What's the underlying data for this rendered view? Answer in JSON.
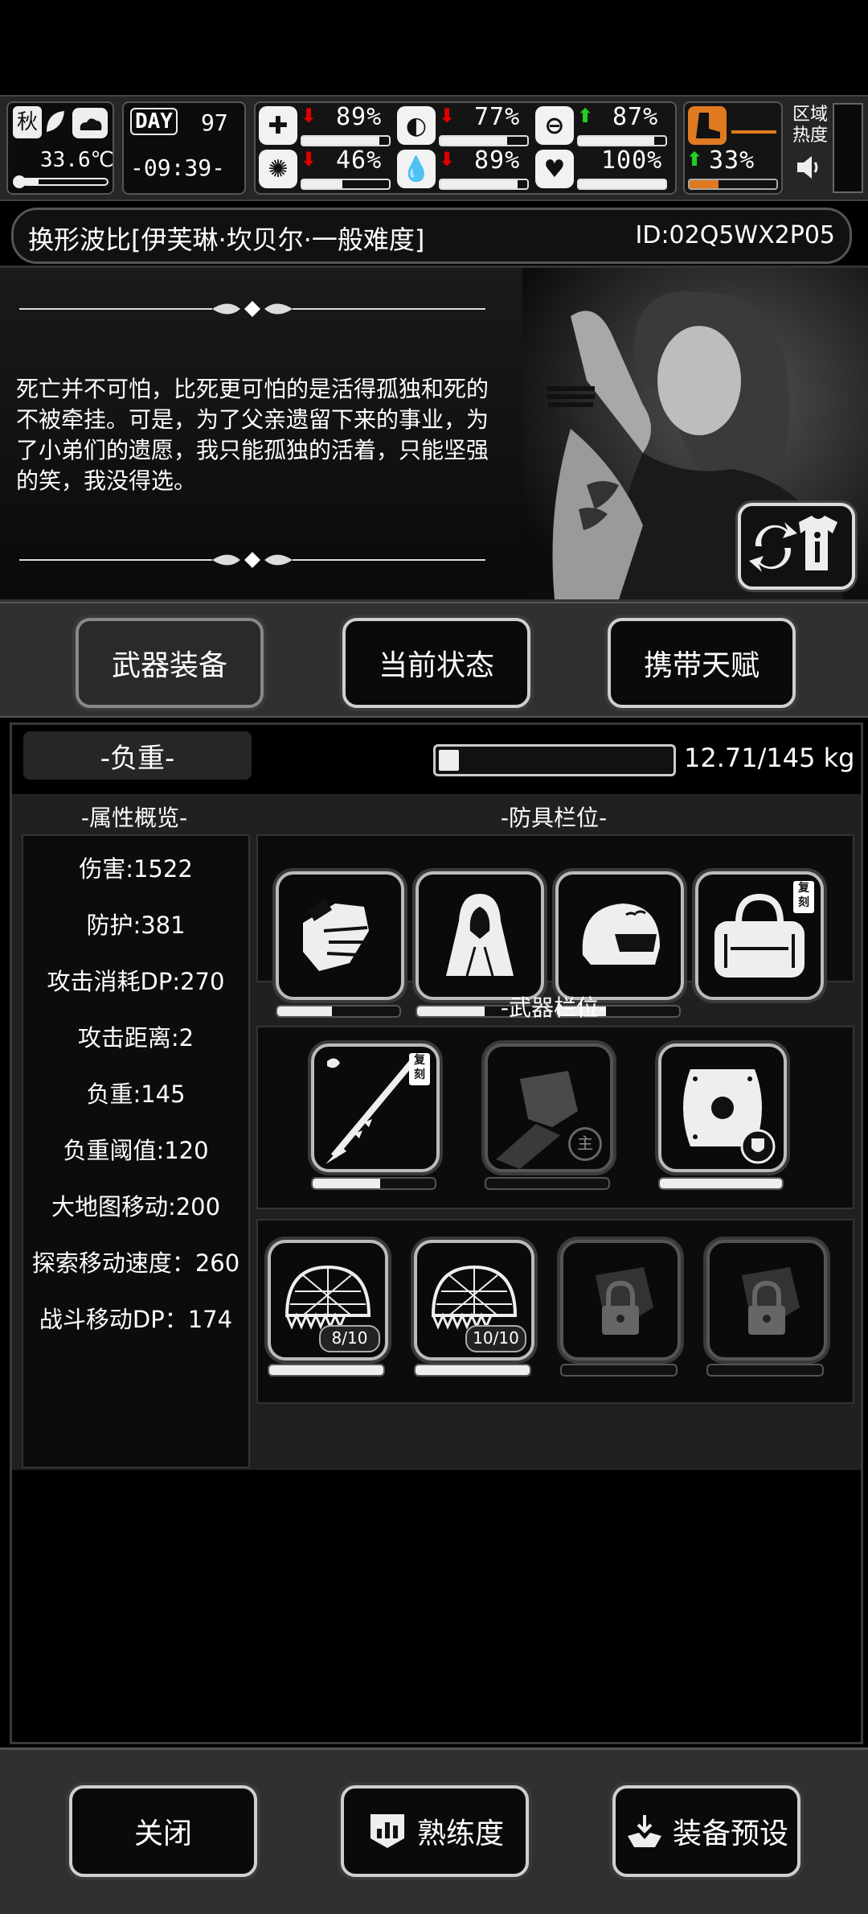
{
  "status": {
    "season": "秋",
    "temperature": "33.6℃",
    "day_label": "DAY",
    "day_value": "97",
    "clock": "-09:39-",
    "stats": [
      {
        "name": "health",
        "trend": "down",
        "value": "89%",
        "level": 0.89
      },
      {
        "name": "hunger",
        "trend": "down",
        "value": "77%",
        "level": 0.77
      },
      {
        "name": "stamina",
        "trend": "up",
        "value": "87%",
        "level": 0.87
      },
      {
        "name": "mind",
        "trend": "down",
        "value": "46%",
        "level": 0.46
      },
      {
        "name": "thirst",
        "trend": "down",
        "value": "89%",
        "level": 0.89
      },
      {
        "name": "heart",
        "trend": "none",
        "value": "100%",
        "level": 1.0
      },
      {
        "name": "speed",
        "trend": "up",
        "value": "33%",
        "level": 0.33
      }
    ],
    "region_heat_label": "区域\n热度"
  },
  "title": {
    "character": "换形波比[伊芙琳·坎贝尔·一般难度]",
    "id": "ID:02Q5WX2P05"
  },
  "bio": "死亡并不可怕，比死更可怕的是活得孤独和死的不被牵挂。可是，为了父亲遗留下来的事业，为了小弟们的遗愿，我只能孤独的活着，只能坚强的笑，我没得选。",
  "tabs": [
    "武器装备",
    "当前状态",
    "携带天赋"
  ],
  "weight": {
    "label": "-负重-",
    "text": "12.71/145 kg",
    "fraction": 0.088
  },
  "attributes": {
    "header": "-属性概览-",
    "items": [
      "伤害:1522",
      "防护:381",
      "攻击消耗DP:270",
      "攻击距离:2",
      "负重:145",
      "负重阈值:120",
      "大地图移动:200",
      "探索移动速度：260",
      "战斗移动DP：174"
    ]
  },
  "armor": {
    "header": "-防具栏位-",
    "slots": [
      {
        "icon": "gloves-icon",
        "durability": 0.45,
        "badge": ""
      },
      {
        "icon": "cloak-icon",
        "durability": 0.55,
        "badge": ""
      },
      {
        "icon": "helmet-icon",
        "durability": 0.4,
        "badge": ""
      },
      {
        "icon": "bag-icon",
        "durability": null,
        "badge": "复刻"
      }
    ]
  },
  "weapons": {
    "header": "-武器栏位-",
    "slots": [
      {
        "icon": "spear-icon",
        "durability": 0.55,
        "badge": "复刻"
      },
      {
        "icon": "fist-icon",
        "durability": 0.0,
        "badge": "主"
      },
      {
        "icon": "shield-icon",
        "durability": 1.0,
        "badge": ""
      }
    ]
  },
  "consumables": {
    "slots": [
      {
        "icon": "net-icon",
        "count": "8/10",
        "durability": 1.0
      },
      {
        "icon": "net-icon",
        "count": "10/10",
        "durability": 1.0
      },
      {
        "icon": "lock-icon",
        "count": "",
        "durability": 0
      },
      {
        "icon": "lock-icon",
        "count": "",
        "durability": 0
      }
    ]
  },
  "bottom": {
    "close": "关闭",
    "proficiency": "熟练度",
    "preset": "装备预设"
  }
}
